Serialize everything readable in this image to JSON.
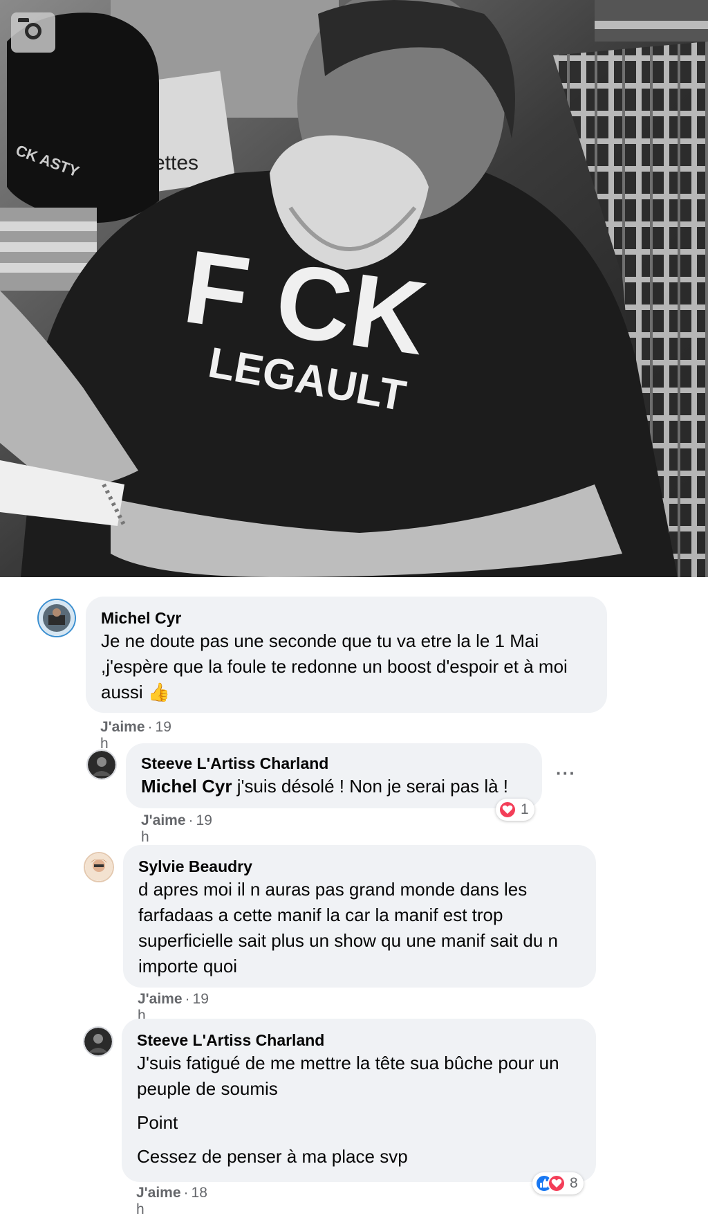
{
  "photo": {
    "shirt_text": "F  CK",
    "shirt_text_bottom": "LEGAULT",
    "cap_text": "CK\nASTY",
    "sign_text": "ettes"
  },
  "comments": [
    {
      "author": "Michel Cyr",
      "lines": [
        "Je ne doute pas une seconde que tu va etre la le 1 Mai ,j'espère que la foule te redonne un boost d'espoir et à moi aussi 👍"
      ],
      "like_label": "J'aime",
      "time": "19 h"
    },
    {
      "author": "Steeve L'Artiss Charland",
      "mention": "Michel Cyr",
      "text_after_mention": " j'suis désolé ! Non je serai pas là !",
      "like_label": "J'aime",
      "time": "19 h",
      "reaction_count": "1",
      "more_label": "···"
    },
    {
      "author": "Sylvie Beaudry",
      "lines": [
        "d apres moi il n auras pas grand monde dans les farfadaas a cette manif la car la manif est trop superficielle sait plus un show qu une manif sait du n importe quoi"
      ],
      "like_label": "J'aime",
      "time": "19 h"
    },
    {
      "author": "Steeve L'Artiss Charland",
      "lines": [
        "J'suis fatigué de me mettre la tête sua bûche pour un peuple de soumis",
        "Point",
        "Cessez de penser à ma place svp"
      ],
      "like_label": "J'aime",
      "time": "18 h",
      "reaction_count": "8"
    }
  ],
  "colors": {
    "bubble": "#f0f2f5",
    "meta": "#65676b",
    "love": "#f33e58",
    "like": "#1877f2"
  }
}
